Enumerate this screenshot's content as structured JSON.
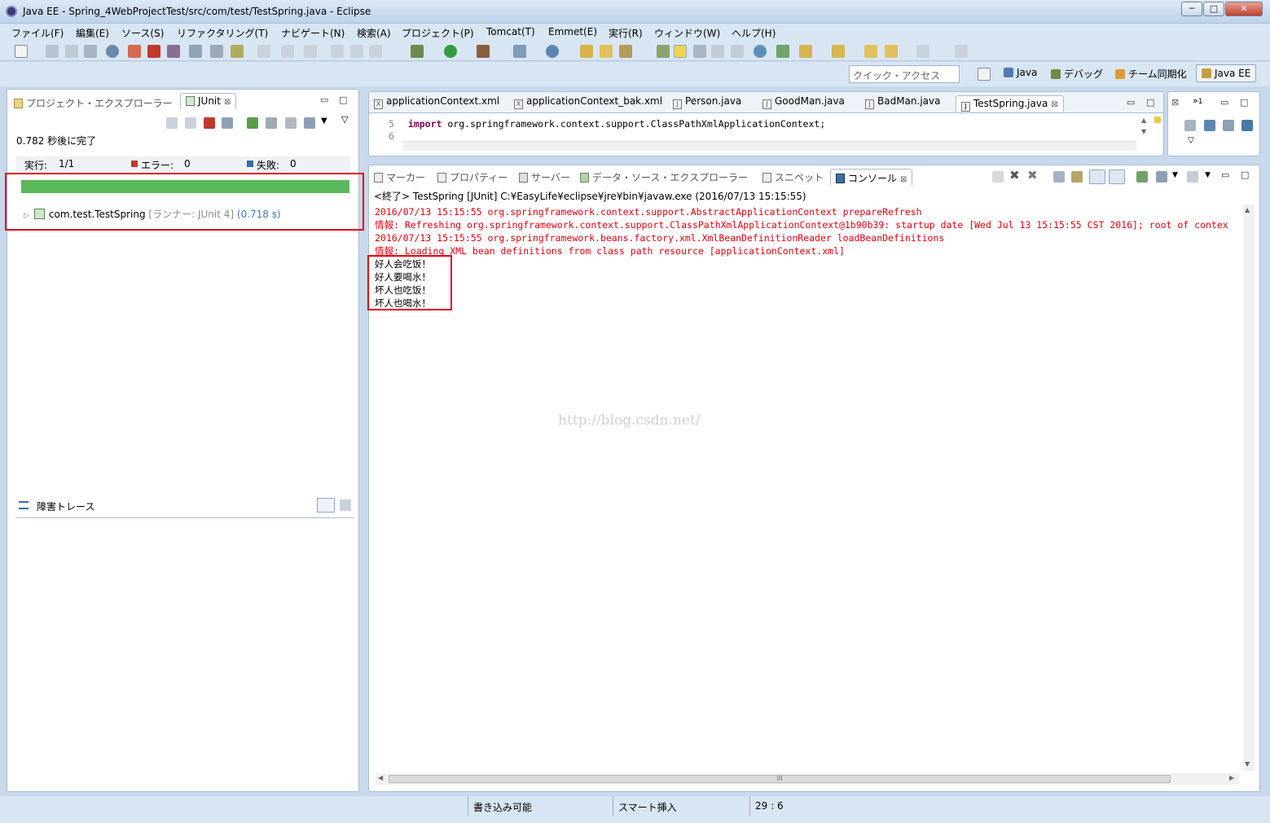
{
  "window": {
    "title": "Java EE - Spring_4WebProjectTest/src/com/test/TestSpring.java - Eclipse",
    "buttons": {
      "minimize": "─",
      "maximize": "□",
      "close": "✕"
    }
  },
  "menu": [
    "ファイル(F)",
    "編集(E)",
    "ソース(S)",
    "リファクタリング(T)",
    "ナビゲート(N)",
    "検索(A)",
    "プロジェクト(P)",
    "Tomcat(T)",
    "Emmet(E)",
    "実行(R)",
    "ウィンドウ(W)",
    "ヘルプ(H)"
  ],
  "quick_access": {
    "placeholder": "クイック・アクセス"
  },
  "perspectives": {
    "java": "Java",
    "debug": "デバッグ",
    "team": "チーム同期化",
    "javaee": "Java EE"
  },
  "left_tabs": {
    "project_explorer": "プロジェクト・エクスプローラー",
    "junit": "JUnit"
  },
  "junit": {
    "finished": "0.782 秒後に完了",
    "runs_label": "実行:",
    "runs_value": "1/1",
    "errors_label": "エラー:",
    "errors_value": "0",
    "failures_label": "失敗:",
    "failures_value": "0",
    "progress": 1.0,
    "progress_color": "#5cb85c",
    "test_name": "com.test.TestSpring",
    "runner": "[ランナー: JUnit 4]",
    "time": "(0.718 s)"
  },
  "failure_trace": {
    "title": "障害トレース"
  },
  "editor": {
    "tabs": [
      "applicationContext.xml",
      "applicationContext_bak.xml",
      "Person.java",
      "GoodMan.java",
      "BadMan.java",
      "TestSpring.java"
    ],
    "tab_icons": [
      "X",
      "X",
      "J",
      "J",
      "J",
      "J"
    ],
    "line5_no": "5",
    "line5_kw": "import",
    "line5_code": "org.springframework.context.support.ClassPathXmlApplicationContext;",
    "line6_no": "6"
  },
  "outline_badge": "1",
  "console_tabs": {
    "markers": "マーカー",
    "properties": "プロパティー",
    "servers": "サーバー",
    "data_source": "データ・ソース・エクスプローラー",
    "snippets": "スニペット",
    "console": "コンソール"
  },
  "console": {
    "header": "<終了> TestSpring [JUnit] C:¥EasyLife¥eclipse¥jre¥bin¥javaw.exe (2016/07/13 15:15:55)",
    "log_lines": [
      "2016/07/13 15:15:55 org.springframework.context.support.AbstractApplicationContext prepareRefresh",
      "情報: Refreshing org.springframework.context.support.ClassPathXmlApplicationContext@1b90b39: startup date [Wed Jul 13 15:15:55 CST 2016]; root of contex",
      "2016/07/13 15:15:55 org.springframework.beans.factory.xml.XmlBeanDefinitionReader loadBeanDefinitions",
      "情報: Loading XML bean definitions from class path resource [applicationContext.xml]"
    ],
    "output_lines": [
      "好人会吃饭！",
      "好人要喝水！",
      "坏人也吃饭！",
      "坏人也喝水！"
    ],
    "watermark": "http://blog.csdn.net/",
    "hscroll_grip": "III",
    "log_color": "#e3000f"
  },
  "status": {
    "writable": "書き込み可能",
    "insert": "スマート挿入",
    "position": "29 : 6"
  }
}
